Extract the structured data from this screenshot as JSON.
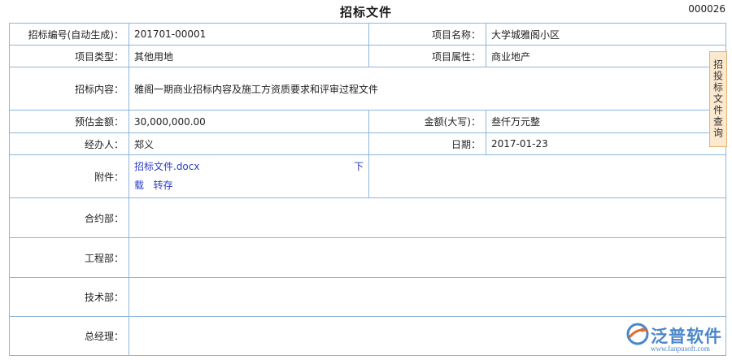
{
  "header": {
    "title": "招标文件",
    "doc_number": "000026"
  },
  "form": {
    "bid_no_label": "招标编号(自动生成)：",
    "bid_no_value": "201701-00001",
    "project_name_label": "项目名称：",
    "project_name_value": "大学城雅阁小区",
    "project_type_label": "项目类型：",
    "project_type_value": "其他用地",
    "project_attr_label": "项目属性：",
    "project_attr_value": "商业地产",
    "content_label": "招标内容：",
    "content_value": "雅阁一期商业招标内容及施工方资质要求和评审过程文件",
    "est_amount_label": "预估金额：",
    "est_amount_value": "30,000,000.00",
    "amount_upper_label": "金额(大写)：",
    "amount_upper_value": "叁仟万元整",
    "handler_label": "经办人：",
    "handler_value": "郑义",
    "date_label": "日期：",
    "date_value": "2017-01-23",
    "attachment_label": "附件：",
    "attachment_file": "招标文件.docx",
    "attachment_download_1": "下",
    "attachment_download_2": "载",
    "attachment_transfer": "转存",
    "contract_dept_label": "合约部：",
    "engineering_dept_label": "工程部：",
    "tech_dept_label": "技术部：",
    "gm_label": "总经理："
  },
  "side_tab": {
    "label": "招投标文件查询"
  },
  "logo": {
    "name": "泛普软件",
    "url": "www.fanpusoft.com"
  },
  "colors": {
    "border": "#8fb6d9",
    "link": "#2a3cc7",
    "side_tab_bg": "#fbe9cf",
    "brand": "#4a87c9"
  }
}
